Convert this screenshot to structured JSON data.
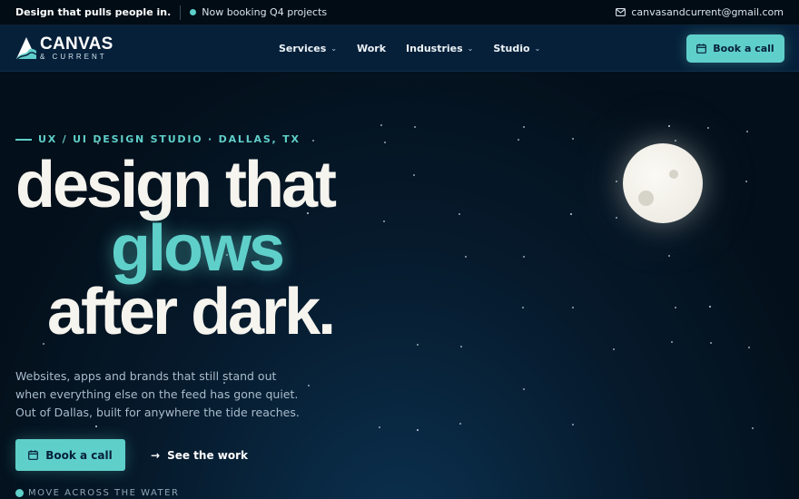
{
  "topbar": {
    "tagline": "Design that pulls people in.",
    "status": "Now booking Q4 projects",
    "email": "canvasandcurrent@gmail.com",
    "email_icon": "mail-icon"
  },
  "nav": {
    "logo_word": "CANVAS",
    "logo_sub": "& CURRENT",
    "links": [
      {
        "label": "Services",
        "dropdown": true
      },
      {
        "label": "Work",
        "dropdown": false
      },
      {
        "label": "Industries",
        "dropdown": true
      },
      {
        "label": "Studio",
        "dropdown": true
      }
    ],
    "cta_label": "Book a call",
    "cta_icon": "calendar-icon"
  },
  "hero": {
    "eyebrow": "UX / UI DESIGN STUDIO · DALLAS, TX",
    "headline_line1": "design that",
    "headline_line2": "glows",
    "headline_line3": "after dark.",
    "lead": "Websites, apps and brands that still stand out when everything else on the feed has gone quiet. Out of Dallas, built for anywhere the tide reaches.",
    "primary_cta": "Book a call",
    "secondary_cta": "See the work",
    "scroll_hint": "MOVE ACROSS THE WATER"
  },
  "colors": {
    "accent": "#5fcfc9",
    "background": "#03121f",
    "nav_bg": "#06203a",
    "moon": "#f3f1ea"
  }
}
